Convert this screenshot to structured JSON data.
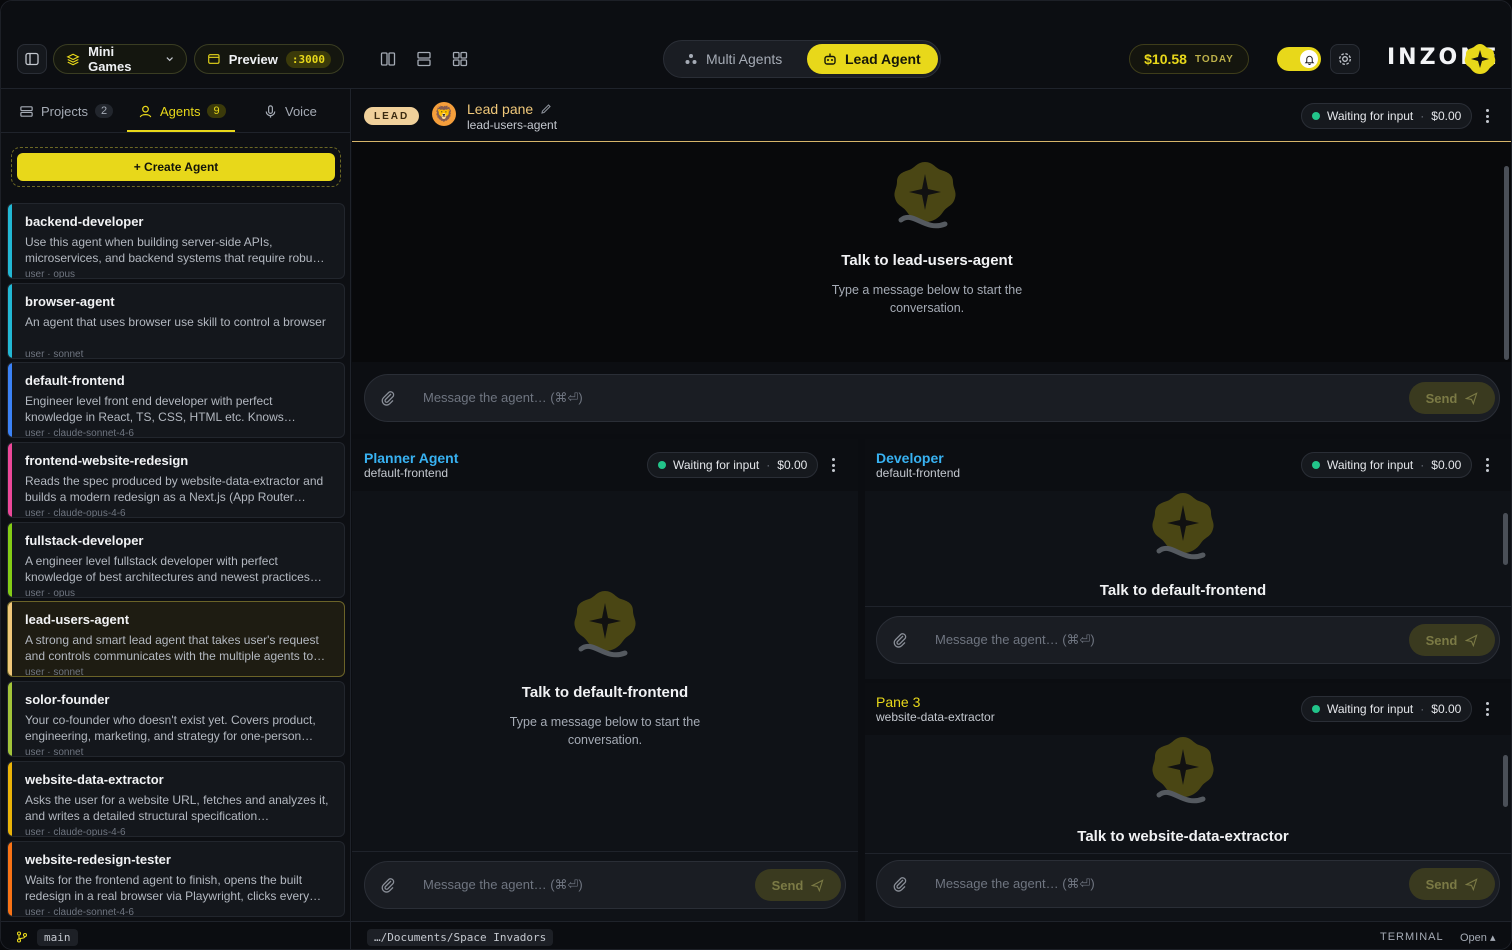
{
  "header": {
    "project_label": "Mini Games",
    "preview_label": "Preview",
    "preview_port": ":3000",
    "mode_multi": "Multi Agents",
    "mode_lead": "Lead Agent",
    "cost_value": "$10.58",
    "cost_period": "TODAY",
    "brand": "INZONE",
    "accent_color": "#e8d81a"
  },
  "sidebar": {
    "tabs": [
      {
        "label": "Projects",
        "count": "2"
      },
      {
        "label": "Agents",
        "count": "9"
      },
      {
        "label": "Voice"
      }
    ],
    "create_label": "+ Create Agent",
    "agents": [
      {
        "name": "backend-developer",
        "desc": "Use this agent when building server-side APIs, microservices, and backend systems that require robu…",
        "meta": "user · opus",
        "color": "#22b8d4"
      },
      {
        "name": "browser-agent",
        "desc": "An agent that uses browser use skill to control a browser",
        "meta": "user · sonnet",
        "color": "#22b8d4"
      },
      {
        "name": "default-frontend",
        "desc": "Engineer level front end developer with perfect knowledge in React, TS, CSS, HTML etc. Knows…",
        "meta": "user · claude-sonnet-4-6",
        "color": "#3b82f6"
      },
      {
        "name": "frontend-website-redesign",
        "desc": "Reads the spec produced by website-data-extractor and builds a modern redesign as a Next.js (App Router…",
        "meta": "user · claude-opus-4-6",
        "color": "#ec4899"
      },
      {
        "name": "fullstack-developer",
        "desc": "A engineer level fullstack developer with perfect knowledge of best architectures and newest practices…",
        "meta": "user · opus",
        "color": "#84cc16"
      },
      {
        "name": "lead-users-agent",
        "desc": "A strong and smart lead agent that takes user's request and controls communicates with the multiple agents to…",
        "meta": "user · sonnet",
        "color": "#f0c87a"
      },
      {
        "name": "solor-founder",
        "desc": "Your co-founder who doesn't exist yet. Covers product, engineering, marketing, and strategy for one-person…",
        "meta": "user · sonnet",
        "color": "#a3c43a"
      },
      {
        "name": "website-data-extractor",
        "desc": "Asks the user for a website URL, fetches and analyzes it, and writes a detailed structural specification…",
        "meta": "user · claude-opus-4-6",
        "color": "#eab308"
      },
      {
        "name": "website-redesign-tester",
        "desc": "Waits for the frontend agent to finish, opens the built redesign in a real browser via Playwright, clicks every…",
        "meta": "user · claude-sonnet-4-6",
        "color": "#f97316"
      }
    ],
    "branch": "main"
  },
  "lead_pane": {
    "badge": "LEAD",
    "title": "Lead pane",
    "subtitle": "lead-users-agent",
    "status": "Waiting for input",
    "cost": "$0.00",
    "empty_title": "Talk to lead-users-agent",
    "empty_text": "Type a message below to start the conversation.",
    "placeholder": "Message the agent… (⌘⏎)",
    "send": "Send"
  },
  "planner_pane": {
    "title": "Planner Agent",
    "subtitle": "default-frontend",
    "status": "Waiting for input",
    "cost": "$0.00",
    "empty_title": "Talk to default-frontend",
    "empty_text": "Type a message below to start the conversation.",
    "placeholder": "Message the agent… (⌘⏎)",
    "send": "Send"
  },
  "developer_pane": {
    "title": "Developer",
    "subtitle": "default-frontend",
    "status": "Waiting for input",
    "cost": "$0.00",
    "empty_title": "Talk to default-frontend",
    "placeholder": "Message the agent… (⌘⏎)",
    "send": "Send"
  },
  "pane3": {
    "title": "Pane 3",
    "subtitle": "website-data-extractor",
    "status": "Waiting for input",
    "cost": "$0.00",
    "empty_title": "Talk to website-data-extractor",
    "placeholder": "Message the agent… (⌘⏎)",
    "send": "Send"
  },
  "footer": {
    "path": "…/Documents/Space Invadors",
    "terminal": "TERMINAL",
    "open": "Open ▴"
  }
}
